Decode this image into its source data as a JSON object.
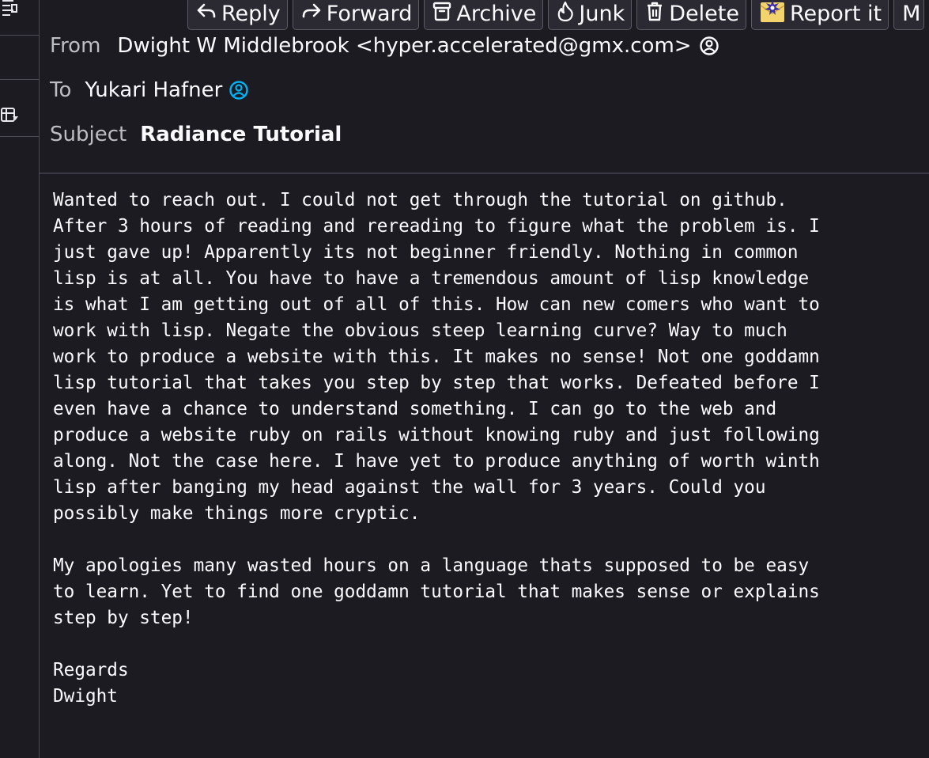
{
  "toolbar": {
    "reply": "Reply",
    "forward": "Forward",
    "archive": "Archive",
    "junk": "Junk",
    "delete": "Delete",
    "report": "Report it",
    "more": "M"
  },
  "header": {
    "from_label": "From",
    "from_value": "Dwight W Middlebrook <hyper.accelerated@gmx.com>",
    "to_label": "To",
    "to_value": "Yukari Hafner",
    "subject_label": "Subject",
    "subject_value": "Radiance Tutorial"
  },
  "message": {
    "body": "Wanted to reach out. I could not get through the tutorial on github.\nAfter 3 hours of reading and rereading to figure what the problem is. I\njust gave up! Apparently its not beginner friendly. Nothing in common\nlisp is at all. You have to have a tremendous amount of lisp knowledge\nis what I am getting out of all of this. How can new comers who want to\nwork with lisp. Negate the obvious steep learning curve? Way to much\nwork to produce a website with this. It makes no sense! Not one goddamn\nlisp tutorial that takes you step by step that works. Defeated before I\neven have a chance to understand something. I can go to the web and\nproduce a website ruby on rails without knowing ruby and just following\nalong. Not the case here. I have yet to produce anything of worth winth\nlisp after banging my head against the wall for 3 years. Could you\npossibly make things more cryptic.\n\nMy apologies many wasted hours on a language thats supposed to be easy\nto learn. Yet to find one goddamn tutorial that makes sense or explains\nstep by step!\n\nRegards\nDwight"
  },
  "icons": {
    "reply": "reply-icon",
    "forward": "forward-icon",
    "archive": "archive-icon",
    "junk": "junk-flame-icon",
    "delete": "trash-icon",
    "report": "report-icon",
    "from_contact": "contact-icon",
    "to_contact": "contact-icon",
    "side_list": "list-icon",
    "side_table": "table-icon"
  },
  "colors": {
    "background": "#1c1b22",
    "button_bg": "#2b2a33",
    "text": "#fbfbfe",
    "label": "#bdbdc4",
    "contact_accent": "#00b3f4"
  }
}
